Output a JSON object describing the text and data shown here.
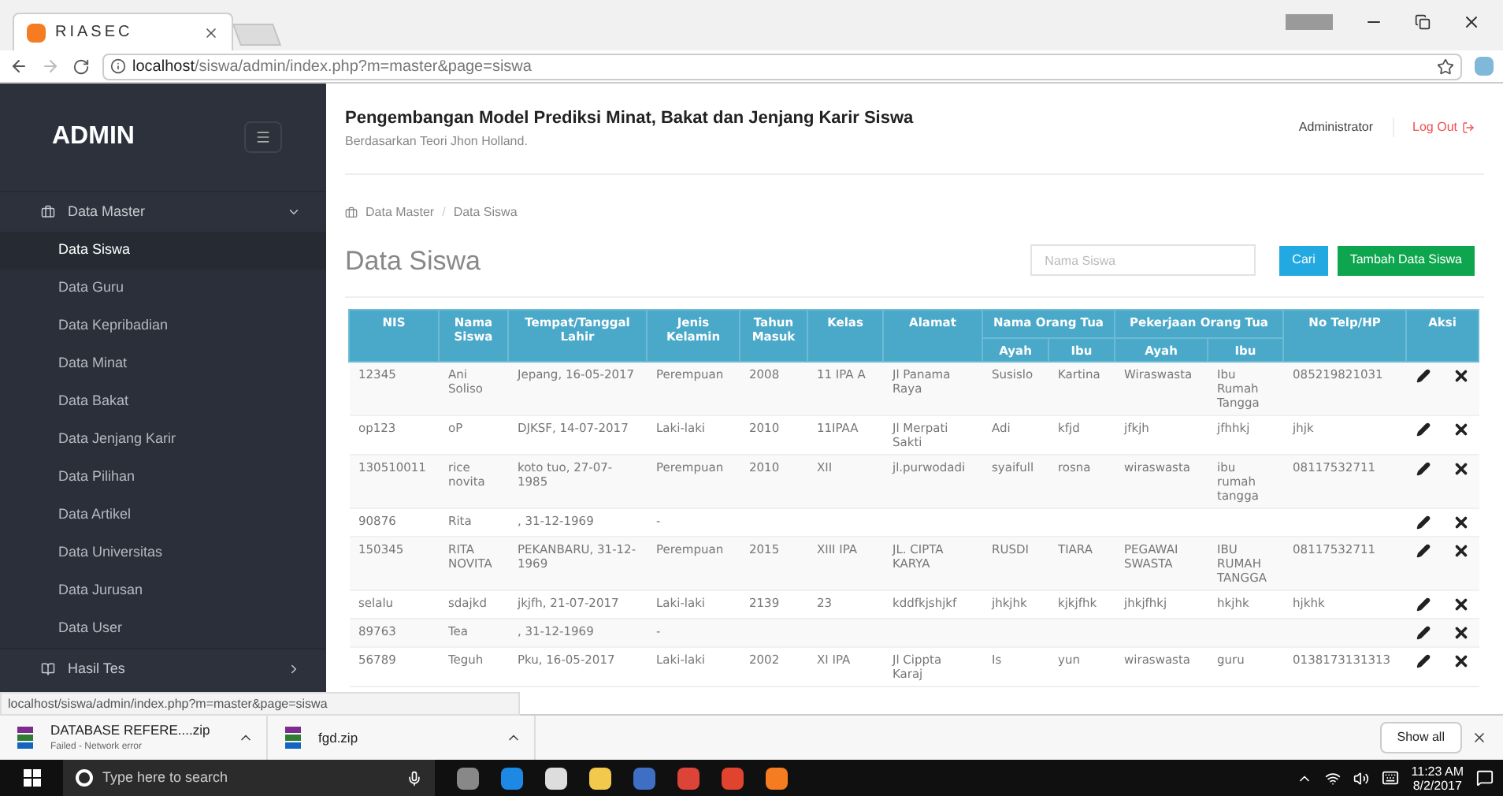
{
  "browser": {
    "tab_title": "RIASEC",
    "url_host": "localhost",
    "url_path": "/siswa/admin/index.php?m=master&page=siswa"
  },
  "sidebar": {
    "brand": "ADMIN",
    "sections": [
      {
        "label": "Data Master",
        "expanded": true,
        "children": [
          {
            "label": "Data Siswa",
            "selected": true
          },
          {
            "label": "Data Guru",
            "selected": false
          },
          {
            "label": "Data Kepribadian",
            "selected": false
          },
          {
            "label": "Data Minat",
            "selected": false
          },
          {
            "label": "Data Bakat",
            "selected": false
          },
          {
            "label": "Data Jenjang Karir",
            "selected": false
          },
          {
            "label": "Data Pilihan",
            "selected": false
          },
          {
            "label": "Data Artikel",
            "selected": false
          },
          {
            "label": "Data Universitas",
            "selected": false
          },
          {
            "label": "Data Jurusan",
            "selected": false
          },
          {
            "label": "Data User",
            "selected": false
          }
        ]
      },
      {
        "label": "Hasil Tes",
        "expanded": false
      }
    ]
  },
  "header": {
    "title": "Pengembangan Model Prediksi Minat, Bakat dan Jenjang Karir Siswa",
    "subtitle": "Berdasarkan Teori Jhon Holland.",
    "user": "Administrator",
    "logout": "Log Out"
  },
  "breadcrumb": [
    "Data Master",
    "Data Siswa"
  ],
  "breadcrumb_separator": "/",
  "page_title": "Data Siswa",
  "search": {
    "placeholder": "Nama Siswa"
  },
  "buttons": {
    "search": "Cari",
    "add": "Tambah Data Siswa"
  },
  "table": {
    "columns": [
      {
        "label": "NIS"
      },
      {
        "label": "Nama Siswa"
      },
      {
        "label": "Tempat/Tanggal Lahir"
      },
      {
        "label": "Jenis Kelamin"
      },
      {
        "label": "Tahun Masuk"
      },
      {
        "label": "Kelas"
      },
      {
        "label": "Alamat"
      },
      {
        "label": "Nama Orang Tua",
        "colspan": 2,
        "children": [
          "Ayah",
          "Ibu"
        ]
      },
      {
        "label": "Pekerjaan Orang Tua",
        "colspan": 2,
        "children": [
          "Ayah",
          "Ibu"
        ]
      },
      {
        "label": "No Telp/HP"
      },
      {
        "label": "Aksi"
      }
    ],
    "rows": [
      [
        "12345",
        "Ani Soliso",
        "Jepang, 16-05-2017",
        "Perempuan",
        "2008",
        "11 IPA A",
        "Jl Panama Raya",
        "Susislo",
        "Kartina",
        "Wiraswasta",
        "Ibu Rumah Tangga",
        "085219821031"
      ],
      [
        "op123",
        "oP",
        "DJKSF, 14-07-2017",
        "Laki-laki",
        "2010",
        "11IPAA",
        "Jl Merpati Sakti",
        "Adi",
        "kfjd",
        "jfkjh",
        "jfhhkj",
        "jhjk"
      ],
      [
        "130510011",
        "rice novita",
        "koto tuo, 27-07-1985",
        "Perempuan",
        "2010",
        "XII",
        "jl.purwodadi",
        "syaifull",
        "rosna",
        "wiraswasta",
        "ibu rumah tangga",
        "08117532711"
      ],
      [
        "90876",
        "Rita",
        ", 31-12-1969",
        "-",
        null,
        null,
        null,
        null,
        null,
        null,
        null,
        null
      ],
      [
        "150345",
        "RITA NOVITA",
        "PEKANBARU, 31-12-1969",
        "Perempuan",
        "2015",
        "XIII IPA",
        "JL. CIPTA KARYA",
        "RUSDI",
        "TIARA",
        "PEGAWAI SWASTA",
        "IBU RUMAH TANGGA",
        "08117532711"
      ],
      [
        "selalu",
        "sdajkd",
        "jkjfh, 21-07-2017",
        "Laki-laki",
        "2139",
        "23",
        "kddfkjshjkf",
        "jhkjhk",
        "kjkjfhk",
        "jhkjfhkj",
        "hkjhk",
        "hjkhk"
      ],
      [
        "89763",
        "Tea",
        ", 31-12-1969",
        "-",
        null,
        null,
        null,
        null,
        null,
        null,
        null,
        null
      ],
      [
        "56789",
        "Teguh",
        "Pku, 16-05-2017",
        "Laki-laki",
        "2002",
        "XI IPA",
        "Jl Cippta Karaj",
        "Is",
        "yun",
        "wiraswasta",
        "guru",
        "0138173131313"
      ]
    ]
  },
  "status_url": "localhost/siswa/admin/index.php?m=master&page=siswa",
  "downloads": [
    {
      "name": "DATABASE REFERE....zip",
      "status": "Failed - Network error"
    },
    {
      "name": "fgd.zip"
    }
  ],
  "show_all": "Show all",
  "taskbar": {
    "search_placeholder": "Type here to search",
    "time": "11:23 AM",
    "date": "8/2/2017"
  }
}
